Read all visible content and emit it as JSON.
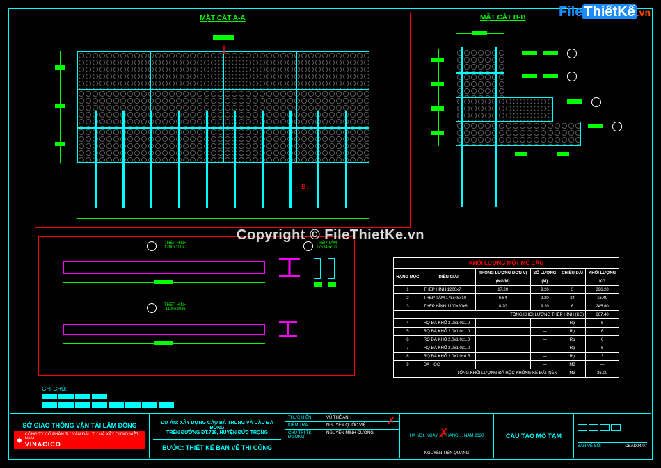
{
  "watermark": {
    "logo_file": "File",
    "logo_thiet": "ThiếtKế",
    "logo_vn": ".vn",
    "center": "Copyright © FileThietKe.vn"
  },
  "sections": {
    "aa_title": "MẶT CẮT A-A",
    "bb_title": "MẶT CẮT B-B"
  },
  "details": {
    "thep_hinh_1": "THÉP HÌNH",
    "thep_hinh_1_dim": "1200x100x7",
    "thep_hinh_2": "THÉP HÌNH",
    "thep_hinh_2_dim": "1100x80x6",
    "thep_tam": "THÉP TẤM",
    "thep_tam_dim": "175x45x10"
  },
  "notes": {
    "heading": "GHI CHÚ:"
  },
  "table": {
    "title": "KHỐI LƯỢNG MỘT MỐ CẦU",
    "headers": {
      "stt": "HẠNG MỤC",
      "desc": "DIỄN GIẢI",
      "unit_weight": "TRỌNG LƯỢNG ĐƠN VỊ",
      "qty": "SỐ LƯỢNG",
      "length": "CHIỀU DÀI",
      "weight": "KHỐI LƯỢNG",
      "unit_sub": "(KG/M)",
      "m_sub": "(M)",
      "kg_sub": "KG"
    },
    "rows": [
      {
        "stt": "1",
        "desc": "THÉP HÌNH 1200x7",
        "uw": "17.20",
        "qty": "9.20",
        "len": "3",
        "kl": "396.20"
      },
      {
        "stt": "2",
        "desc": "THÉP TẤM 175x45x10",
        "uw": "6.64",
        "qty": "9.20",
        "len": "24",
        "kl": "16.40"
      },
      {
        "stt": "3",
        "desc": "THÉP HÌNH 1100x80x6",
        "uw": "8.20",
        "qty": "9.20",
        "len": "6",
        "kl": "245.60"
      }
    ],
    "subtotal_label": "TỔNG KHỐI LƯỢNG THÉP HÌNH (KG)",
    "subtotal_val": "667.40",
    "rows2": [
      {
        "stt": "4",
        "desc": "RỌ ĐÁ KHỔ 2.0x1.0x1.0",
        "uw": "",
        "qty": "—",
        "len": "Rọ",
        "kl": "6"
      },
      {
        "stt": "5",
        "desc": "RỌ ĐÁ KHỔ 2.0x1.0x1.0",
        "uw": "",
        "qty": "—",
        "len": "Rọ",
        "kl": "6"
      },
      {
        "stt": "6",
        "desc": "RỌ ĐÁ KHỔ 2.0x1.0x1.0",
        "uw": "",
        "qty": "—",
        "len": "Rọ",
        "kl": "6"
      },
      {
        "stt": "7",
        "desc": "RỌ ĐÁ KHỔ 2.0x1.0x1.0",
        "uw": "",
        "qty": "—",
        "len": "Rọ",
        "kl": "6"
      },
      {
        "stt": "8",
        "desc": "RỌ ĐÁ KHỔ 2.0x1.0x0.5",
        "uw": "",
        "qty": "—",
        "len": "Rọ",
        "kl": "3"
      },
      {
        "stt": "9",
        "desc": "ĐÁ HỘC",
        "uw": "",
        "qty": "—",
        "len": "M3",
        "kl": "—"
      }
    ],
    "total_label": "TỔNG KHỐI LƯỢNG ĐÁ HỘC KHÔNG KỀ ĐẤT NỀN",
    "total_unit": "M3",
    "total_val": "26.00"
  },
  "titleblock": {
    "owner": "SỞ GIAO THÔNG VẬN TẢI LÂM ĐỒNG",
    "company_line": "CÔNG TY CỔ PHẦN TƯ VẤN ĐẦU TƯ VÀ XÂY DỰNG VIỆT NAM",
    "company_brand": "VINACICO",
    "project_l1": "DỰ ÁN: XÂY DỰNG CẦU BÀ TRUNG VÀ CẦU BÀ ĐỒNG",
    "project_l2": "TRÊN ĐƯỜNG ĐT.729, HUYỆN ĐỨC TRỌNG",
    "step": "BƯỚC: THIẾT KẾ BẢN VẼ THI CÔNG",
    "roles": {
      "thuchien_lbl": "THỰC HIỆN",
      "thuchien_val": "VŨ THẾ ANH",
      "kiemtra_lbl": "KIỂM TRA",
      "kiemtra_val": "NGUYỄN QUỐC VIỆT",
      "chutri_lbl": "CHỦ TRÌ TK ĐƯỜNG",
      "chutri_val": "NGUYỄN MINH CƯỜNG"
    },
    "date": "HÀ NỘI, NGÀY ... THÁNG ... NĂM 2020",
    "signer": "NGUYỄN TIẾN QUANG",
    "drawing_title": "CẤU TẠO MỐ TẠM",
    "sheet_label": "BẢN VẼ SỐ:",
    "sheet_no": "CBAD04/07"
  }
}
